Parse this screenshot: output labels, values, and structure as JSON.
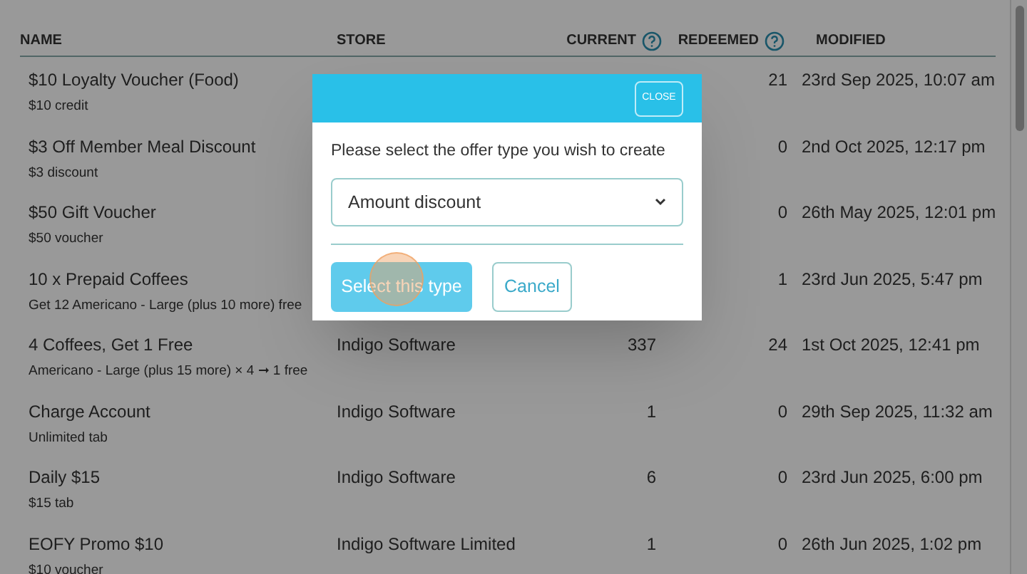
{
  "table": {
    "columns": [
      {
        "label": "NAME",
        "help": false
      },
      {
        "label": "STORE",
        "help": false
      },
      {
        "label": "CURRENT",
        "help": true
      },
      {
        "label": "REDEEMED",
        "help": true
      },
      {
        "label": "MODIFIED",
        "help": false
      }
    ],
    "rows": [
      {
        "name": "$10 Loyalty Voucher (Food)",
        "detail": "$10 credit",
        "redeemed": "21",
        "modified": "23rd Sep 2025, 10:07 am"
      },
      {
        "name": "$3 Off Member Meal Discount",
        "detail": "$3 discount",
        "redeemed": "0",
        "modified": "2nd Oct 2025, 12:17 pm"
      },
      {
        "name": "$50 Gift Voucher",
        "detail": "$50 voucher",
        "redeemed": "0",
        "modified": "26th May 2025, 12:01 pm"
      },
      {
        "name": "10 x Prepaid Coffees",
        "detail": "Get 12 Americano - Large (plus 10 more) free",
        "redeemed": "1",
        "modified": "23rd Jun 2025, 5:47 pm"
      },
      {
        "name": "4 Coffees, Get 1 Free",
        "detail": "Americano - Large (plus 15 more) × 4 ➞ 1 free",
        "store": "Indigo Software",
        "current": "337",
        "redeemed": "24",
        "modified": "1st Oct 2025, 12:41 pm"
      },
      {
        "name": "Charge Account",
        "detail": "Unlimited tab",
        "store": "Indigo Software",
        "current": "1",
        "redeemed": "0",
        "modified": "29th Sep 2025, 11:32 am"
      },
      {
        "name": "Daily $15",
        "detail": "$15 tab",
        "store": "Indigo Software",
        "current": "6",
        "redeemed": "0",
        "modified": "23rd Jun 2025, 6:00 pm"
      },
      {
        "name": "EOFY Promo $10",
        "detail": "$10 voucher",
        "store": "Indigo Software Limited",
        "current": "1",
        "redeemed": "0",
        "modified": "26th Jun 2025, 1:02 pm"
      }
    ]
  },
  "dialog": {
    "close": "CLOSE",
    "prompt": "Please select the offer type you wish to create",
    "select": "Amount discount",
    "primary": "Select this type",
    "secondary": "Cancel"
  }
}
